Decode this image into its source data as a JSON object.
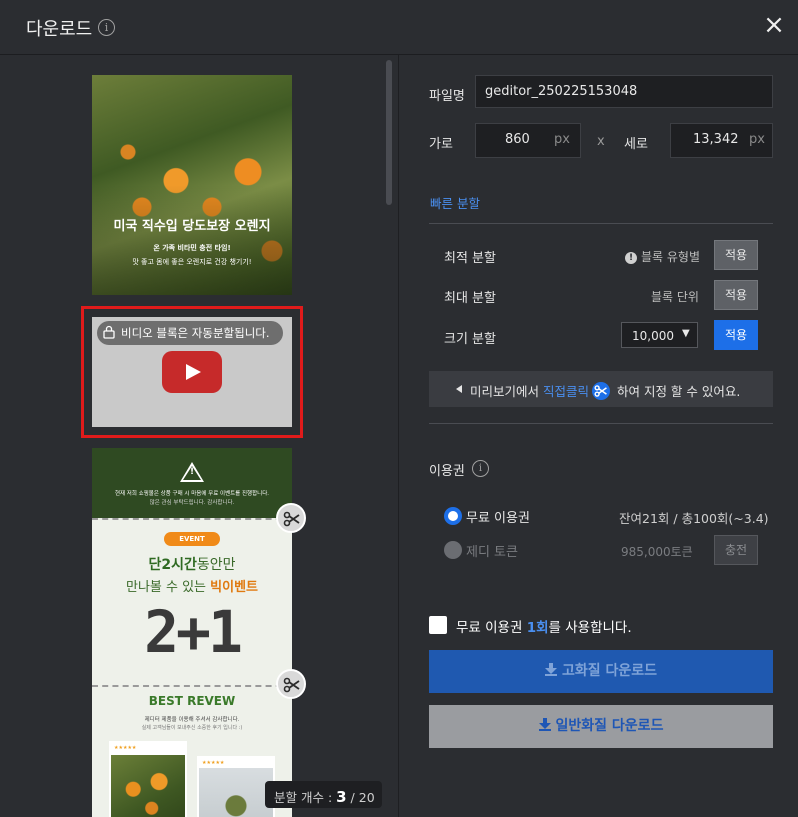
{
  "header": {
    "title": "다운로드",
    "info_glyph": "i",
    "close_glyph": "×"
  },
  "preview": {
    "product": {
      "title": "미국 직수입 당도보장 오렌지",
      "sub1": "온 가족 비타민 충전 타임!",
      "sub2": "맛 좋고 몸에 좋은 오렌지로 건강 챙기기!"
    },
    "video_notice": "비디오 블록은 자동분할됩니다.",
    "event": {
      "notice1": "현재 저희 쇼핑몰은 상품 구매 시 마음에 무료 이벤트를 진행합니다.",
      "notice2": "많은 관심 부탁드립니다. 감사합니다.",
      "badge": "EVENT",
      "line1_bold": "단2시간",
      "line1_rest": "동안만",
      "line2_start": "만나볼 수 있는 ",
      "line2_bold": "빅이벤트",
      "big": "2+1"
    },
    "review": {
      "title": "BEST REVEW",
      "sub1": "제디터 제품을 이용해 주셔서 감사합니다.",
      "sub2": "실제 고객님들이 보내주신 소중한 후기 입니다 :)",
      "stars": "★★★★★"
    },
    "split_count_label": "분할 개수 : ",
    "split_current": "3",
    "split_total": " / 20"
  },
  "settings": {
    "filename_label": "파일명",
    "filename_value": "geditor_250225153048",
    "width_label": "가로",
    "width_value": "860",
    "height_label": "세로",
    "height_value": "13,342",
    "unit": "px",
    "times": "x",
    "quick_split": "빠른 분할",
    "rows": [
      {
        "label": "최적 분할",
        "mode": "블록 유형별",
        "button": "적용"
      },
      {
        "label": "최대 분할",
        "mode": "블록 단위",
        "button": "적용"
      },
      {
        "label": "크기 분할",
        "select": "10,000",
        "button": "적용"
      }
    ],
    "hint_prefix": "미리보기에서 ",
    "hint_highlight": "직접클릭",
    "hint_suffix": " 하여 지정 할 수 있어요."
  },
  "license": {
    "title": "이용권",
    "free_label": "무료 이용권",
    "free_remaining": "잔여21회 / 총100회(~3.4)",
    "token_label": "제디 토큰",
    "token_amount": "985,000토큰",
    "charge_button": "충전",
    "use_prefix": "무료 이용권 ",
    "use_count": "1회",
    "use_suffix": "를 사용합니다."
  },
  "actions": {
    "hq_download": "고화질 다운로드",
    "normal_download": "일반화질 다운로드"
  },
  "colors": {
    "accent": "#1d6fe8",
    "highlight_text": "#4a8ff0",
    "video_outline": "#e01b1b",
    "background": "#2b2d31"
  }
}
